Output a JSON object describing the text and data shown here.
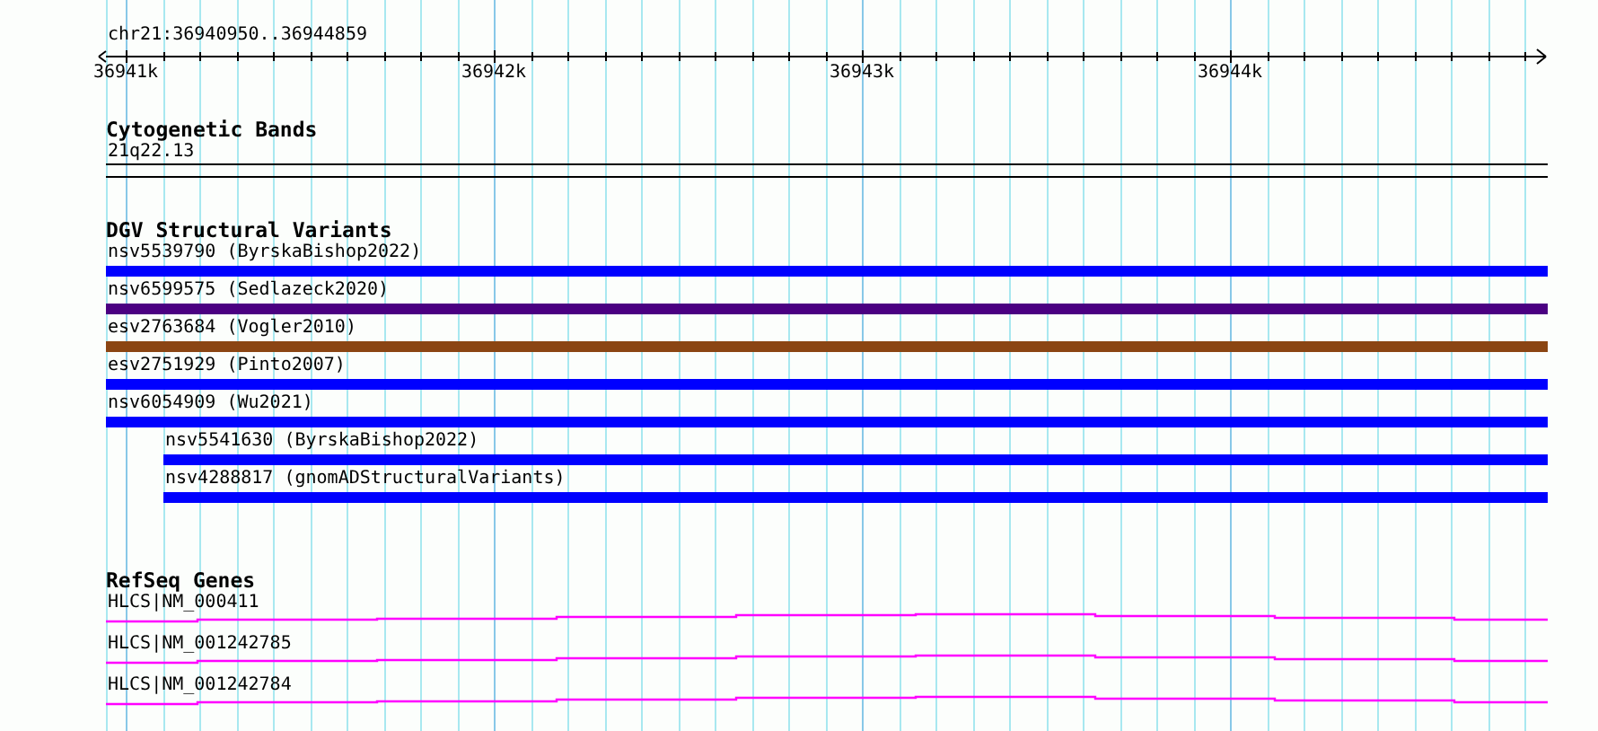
{
  "ruler": {
    "title": "chr21:36940950..36944859",
    "tick_labels": [
      "36941k",
      "36942k",
      "36943k",
      "36944k"
    ]
  },
  "tracks": [
    {
      "kind": "bands",
      "title": "Cytogenetic Bands",
      "features": [
        {
          "label": "21q22.13"
        }
      ]
    },
    {
      "kind": "variants",
      "title": "DGV Structural Variants",
      "features": [
        {
          "label": "nsv5539790 (ByrskaBishop2022)",
          "color": "#0000ff",
          "starts_in_view": false
        },
        {
          "label": "nsv6599575 (Sedlazeck2020)",
          "color": "#4b0082",
          "starts_in_view": false
        },
        {
          "label": "esv2763684 (Vogler2010)",
          "color": "#8b4513",
          "starts_in_view": false
        },
        {
          "label": "esv2751929 (Pinto2007)",
          "color": "#0000ff",
          "starts_in_view": false
        },
        {
          "label": "nsv6054909 (Wu2021)",
          "color": "#0000ff",
          "starts_in_view": false
        },
        {
          "label": "nsv5541630 (ByrskaBishop2022)",
          "color": "#0000ff",
          "starts_in_view": true
        },
        {
          "label": "nsv4288817 (gnomADStructuralVariants)",
          "color": "#0000ff",
          "starts_in_view": true
        }
      ]
    },
    {
      "kind": "genes",
      "title": "RefSeq Genes",
      "features": [
        {
          "label": "HLCS|NM_000411"
        },
        {
          "label": "HLCS|NM_001242785"
        },
        {
          "label": "HLCS|NM_001242784"
        }
      ]
    }
  ]
}
